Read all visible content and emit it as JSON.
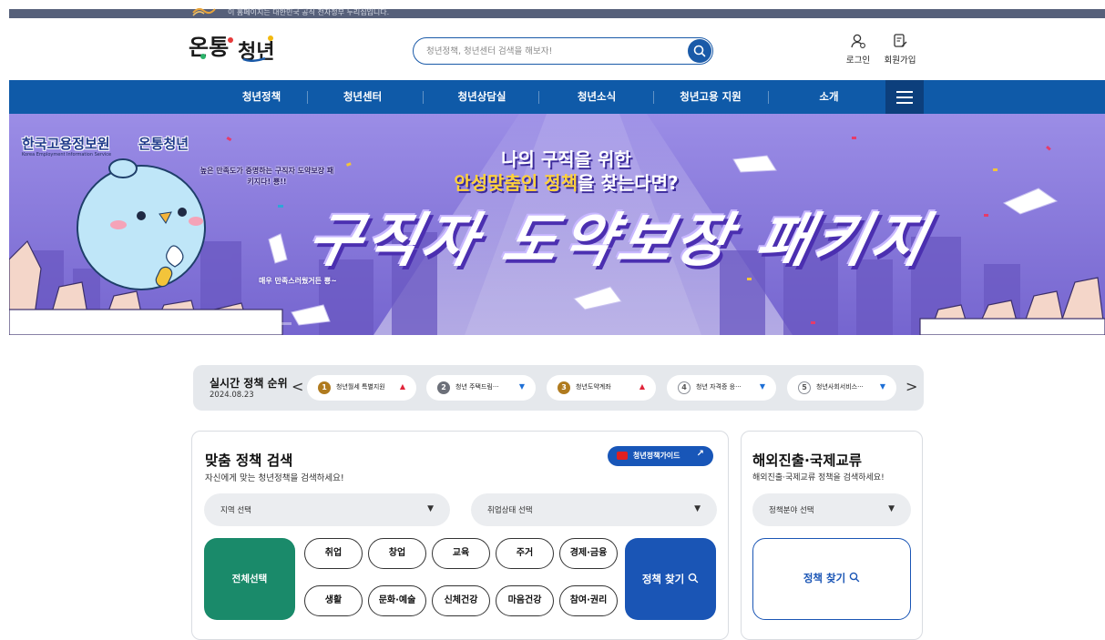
{
  "topbar": {
    "notice": "이 홈페이지는 대한민국 공식 전자정부 누리집입니다."
  },
  "header": {
    "logo_text": "온통청년",
    "search_placeholder": "청년정책, 청년센터 검색을 해보자!",
    "login_label": "로그인",
    "signup_label": "회원가입"
  },
  "nav": {
    "items": [
      "청년정책",
      "청년센터",
      "청년상담실",
      "청년소식",
      "청년고용 지원",
      "소개"
    ]
  },
  "banner": {
    "brand": "한국고용정보원",
    "brand_logo": "온통청년",
    "brand_en": "Korea Employment Information Service",
    "note": "높은 만족도가 증명하는 구직자 도약보장 패키지다! 뿅!!",
    "line1": "나의 구직을 위한",
    "line2_hl": "안성맞춤인 정책",
    "line2_rest": "을 찾는다면?",
    "headline": "구직자 도약보장 패키지",
    "mini": "매우 만족스러웠거든 뿅~",
    "slide_progress": 0.35
  },
  "ranking": {
    "title": "실시간 정책 순위",
    "date": "2024.08.23",
    "prev": "<",
    "next": ">",
    "items": [
      {
        "rank": "1",
        "label": "청년월세 특별지원",
        "trend": "▲"
      },
      {
        "rank": "2",
        "label": "청년 주택드림···",
        "trend": "▼"
      },
      {
        "rank": "3",
        "label": "청년도약계좌",
        "trend": "▲"
      },
      {
        "rank": "4",
        "label": "청년 자격증 응···",
        "trend": "▼"
      },
      {
        "rank": "5",
        "label": "청년사회서비스···",
        "trend": "▼"
      }
    ]
  },
  "custom_search": {
    "title": "맞춤 정책 검색",
    "desc": "자신에게 맞는 청년정책을 검색하세요!",
    "guide_label": "청년정책가이드",
    "ext_icon": "↗",
    "region_select": "지역 선택",
    "job_select": "취업상태 선택",
    "caret": "▼",
    "all_label": "전체선택",
    "categories": [
      "취업",
      "창업",
      "교육",
      "주거",
      "경제·금융",
      "생활",
      "문화·예술",
      "신체건강",
      "마음건강",
      "참여·권리"
    ],
    "find_label": "정책 찾기"
  },
  "overseas": {
    "title": "해외진출·국제교류",
    "desc": "해외진출·국제교류 정책을 검색하세요!",
    "field_select": "정책분야 선택",
    "find_label": "정책 찾기"
  },
  "colors": {
    "nav_bg": "#0f5aa8",
    "banner_bg": "#8a7cd9",
    "all_btn": "#1a8a6a",
    "find_btn": "#1a55b5",
    "trend_up": "#e0253a",
    "trend_down": "#1e6fd6"
  }
}
